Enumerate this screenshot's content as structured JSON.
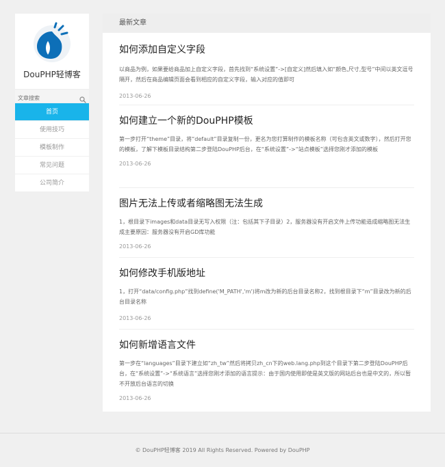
{
  "site": {
    "name": "DouPHP轻博客",
    "brand_color": "#0d6fb8",
    "accent_color": "#19b4ea"
  },
  "search": {
    "placeholder": "文章搜索",
    "icon": "search-icon"
  },
  "nav": [
    {
      "label": "首页",
      "active": true
    },
    {
      "label": "使用技巧",
      "active": false
    },
    {
      "label": "模板制作",
      "active": false
    },
    {
      "label": "常见问题",
      "active": false
    },
    {
      "label": "公司简介",
      "active": false
    }
  ],
  "main": {
    "heading": "最新文章",
    "articles": [
      {
        "title": "如何添加自定义字段",
        "desc": "以商品为例，如果要给商品加上自定义字段，首先找到“系统设置”->[自定义]然后填入如“颜色,尺寸,型号”中间以英文逗号隔开，然后在商品编辑页面会看到相应的自定义字段，输入对应的值即可",
        "date": "2013-06-26"
      },
      {
        "title": "如何建立一个新的DouPHP模板",
        "desc": "第一步打开“theme”目录，将“default”目录复制一份，更名为您打算制作的模板名称（可包含英文或数字），然后打开您的模板，了解下模板目录结构第二步登陆DouPHP后台，在“系统设置”->“站点模板”选择您刚才添加的模板",
        "date": "2013-06-26"
      },
      {
        "title": "图片无法上传或者缩略图无法生成",
        "desc": "1，根目录下images和data目录无写入权限（注：包括其下子目录）2，服务器没有开启文件上传功能造成缩略图无法生成主要原因：服务器没有开启GD库功能",
        "date": "2013-06-26"
      },
      {
        "title": "如何修改手机版地址",
        "desc": "1，打开“data/config.php”找到define('M_PATH','m')将m改为新的后台目录名称2，找到根目录下“m”目录改为新的后台目录名称",
        "date": "2013-06-26"
      },
      {
        "title": "如何新增语言文件",
        "desc": "第一步在“languages”目录下建立如“zh_tw”然后将拷贝zh_cn下的web.lang.php到这个目录下第二步登陆DouPHP后台，在“系统设置”->“系统语言”选择您刚才添加的语言提示：由于国内使用即使是英文版的网站后台也是中文的，所以暂不开放后台语言的切换",
        "date": "2013-06-26"
      }
    ]
  },
  "footer": {
    "text": "© DouPHP轻博客 2019 All Rights Reserved. Powered by DouPHP"
  }
}
